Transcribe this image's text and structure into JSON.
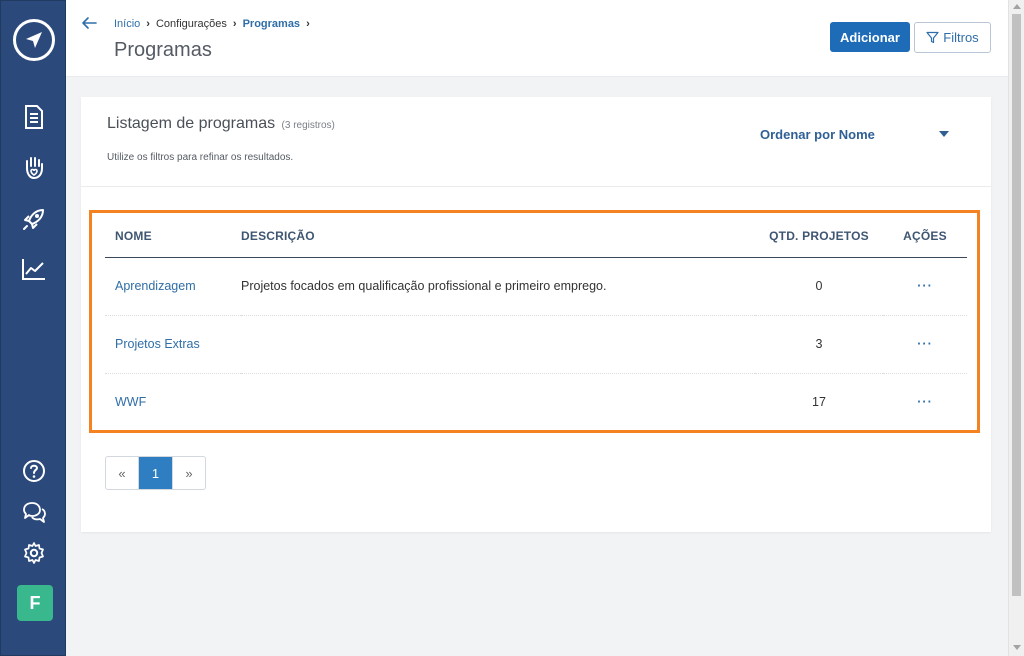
{
  "sidebar": {
    "items": [
      {
        "icon": "document-icon"
      },
      {
        "icon": "hand-heart-icon"
      },
      {
        "icon": "rocket-icon"
      },
      {
        "icon": "chart-line-icon"
      }
    ],
    "bottom": [
      {
        "icon": "help-icon"
      },
      {
        "icon": "chat-icon"
      },
      {
        "icon": "gear-icon"
      }
    ],
    "avatar_letter": "F",
    "avatar_color": "#3ab88d"
  },
  "header": {
    "breadcrumb": [
      "Início",
      "Configurações",
      "Programas"
    ],
    "title": "Programas",
    "add_label": "Adicionar",
    "filter_label": "Filtros"
  },
  "listing": {
    "title": "Listagem de programas",
    "count": "(3 registros)",
    "hint": "Utilize os filtros para refinar os resultados.",
    "sort_label": "Ordenar por Nome"
  },
  "table": {
    "columns": [
      "NOME",
      "DESCRIÇÃO",
      "QTD. PROJETOS",
      "AÇÕES"
    ],
    "rows": [
      {
        "name": "Aprendizagem",
        "description": "Projetos focados em qualificação profissional e primeiro emprego.",
        "count": "0",
        "actions": "···"
      },
      {
        "name": "Projetos Extras",
        "description": "",
        "count": "3",
        "actions": "···"
      },
      {
        "name": "WWF",
        "description": "",
        "count": "17",
        "actions": "···"
      }
    ]
  },
  "pagination": {
    "prev": "«",
    "current": "1",
    "next": "»"
  },
  "colors": {
    "sidebar": "#2b4a7b",
    "primary": "#1e6bb8",
    "highlight": "#f58220"
  }
}
